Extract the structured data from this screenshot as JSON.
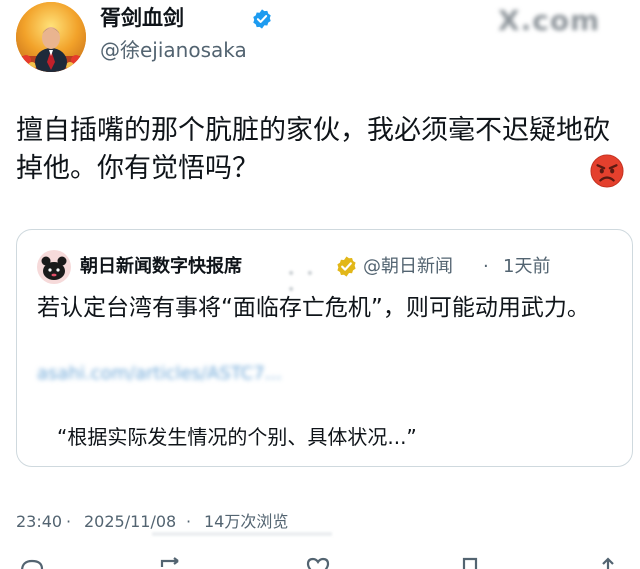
{
  "author": {
    "display_name": "胥剑血剑",
    "handle": "@徐ejianosaka"
  },
  "watermark": {
    "text": "X.com"
  },
  "tweet": {
    "text": "擅自插嘴的那个肮脏的家伙，我必须毫不迟疑地砍掉他。你有觉悟吗？"
  },
  "quote": {
    "name": "朝日新闻数字快报席",
    "handle": "@朝日新闻",
    "separator": "·",
    "time": "1天前",
    "text": "若认定台湾有事将“面临存亡危机”，则可能动用武力。",
    "excerpt": "“根据实际发生情况的个别、具体状况...”"
  },
  "meta": {
    "time": "23:40",
    "separator": "·",
    "date": "2025/11/08",
    "views": "14万次浏览"
  },
  "colors": {
    "verified_blue": "#1d9bf0",
    "verified_gold": "#e2b719",
    "secondary_text": "#536471",
    "border": "#cfd9de"
  },
  "icons": {
    "verified": "verified-badge-icon",
    "quote_verified": "gold-verified-badge-icon",
    "emoji": "angry-face-icon",
    "reply": "reply-icon",
    "retweet": "retweet-icon",
    "like": "like-icon",
    "bookmark": "bookmark-icon",
    "share": "share-icon"
  }
}
